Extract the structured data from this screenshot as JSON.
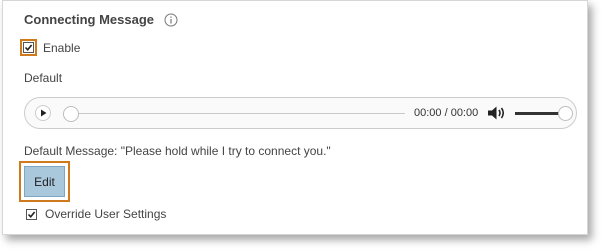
{
  "section": {
    "title": "Connecting Message"
  },
  "enable": {
    "label": "Enable",
    "checked": true
  },
  "default_label": "Default",
  "player": {
    "time": "00:00 / 00:00",
    "progress": 0,
    "volume": 1
  },
  "message": {
    "text": "Default Message: \"Please hold while I try to connect you.\""
  },
  "edit_button": {
    "label": "Edit"
  },
  "override": {
    "label": "Override User Settings",
    "checked": true
  },
  "colors": {
    "highlight": "#d07a1e",
    "button_bg": "#a9c8dc",
    "text": "#444444"
  },
  "icons": {
    "info": "info-circle-icon",
    "play": "play-icon",
    "volume": "volume-icon",
    "check": "checkmark-icon"
  }
}
